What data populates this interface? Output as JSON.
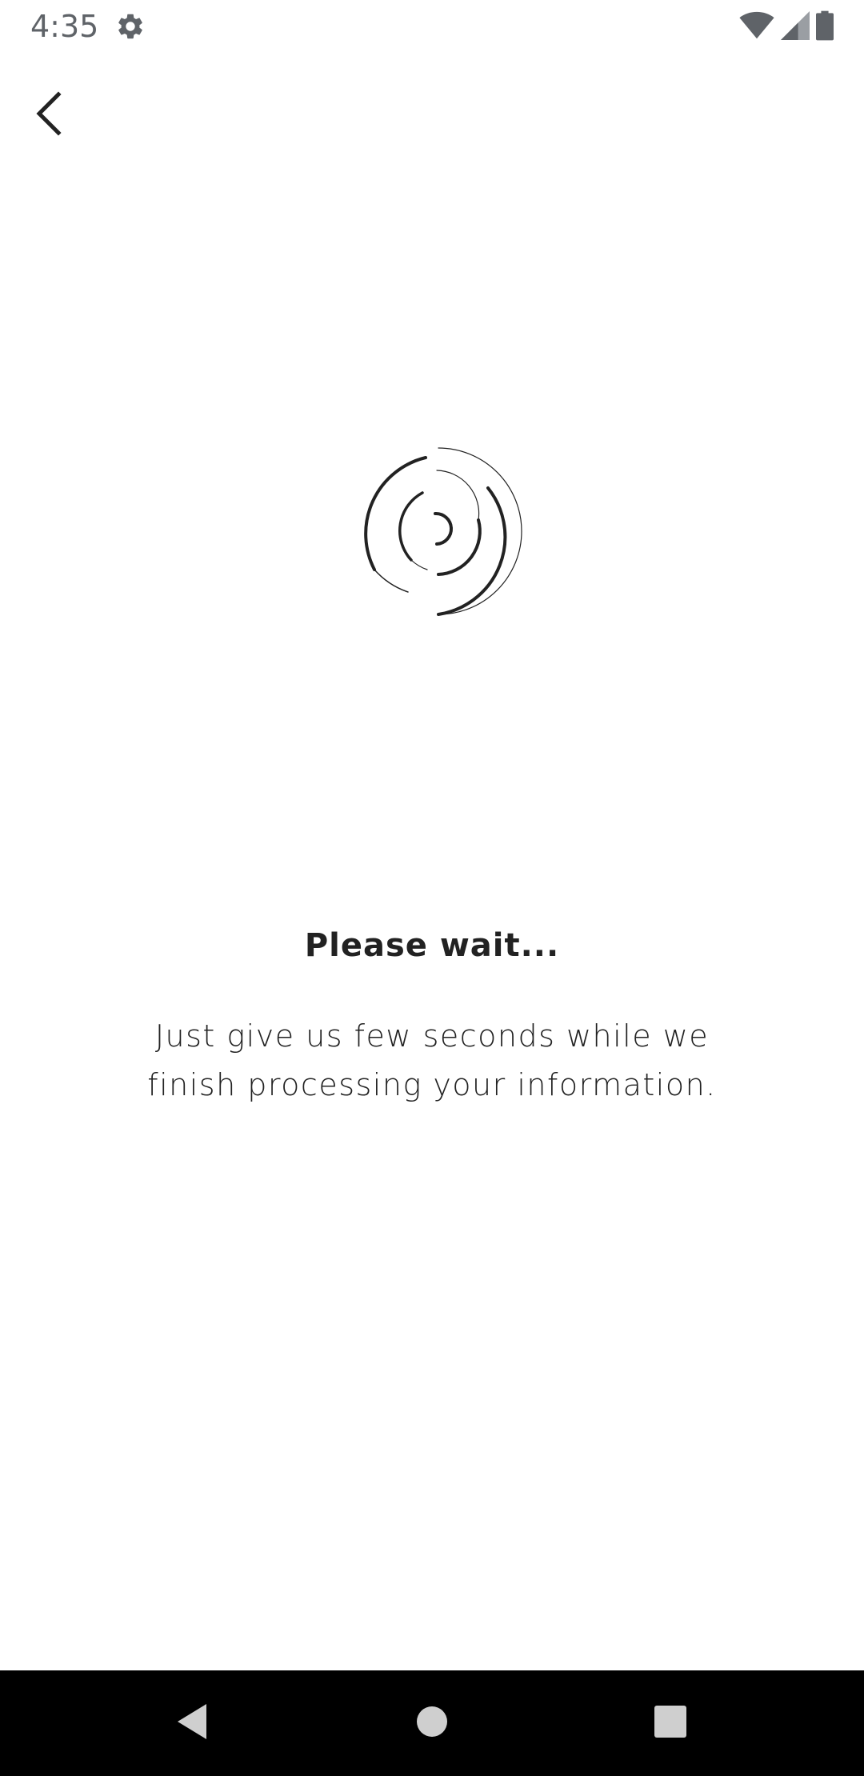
{
  "status_bar": {
    "time": "4:35",
    "icons": [
      "settings-gear-icon",
      "wifi-icon",
      "cellular-signal-icon",
      "battery-icon"
    ],
    "icon_color": "#5f6368"
  },
  "app_bar": {
    "back_icon": "chevron-left-icon"
  },
  "loading": {
    "title": "Please wait...",
    "message": "Just give us few seconds while we finish processing your information.",
    "spinner_icon": "concentric-arc-spinner-icon",
    "text_color": "#222222"
  },
  "nav_bar": {
    "icons": [
      "nav-back-icon",
      "nav-home-icon",
      "nav-recents-icon"
    ],
    "background": "#000000",
    "icon_color": "#cfcfcf"
  }
}
